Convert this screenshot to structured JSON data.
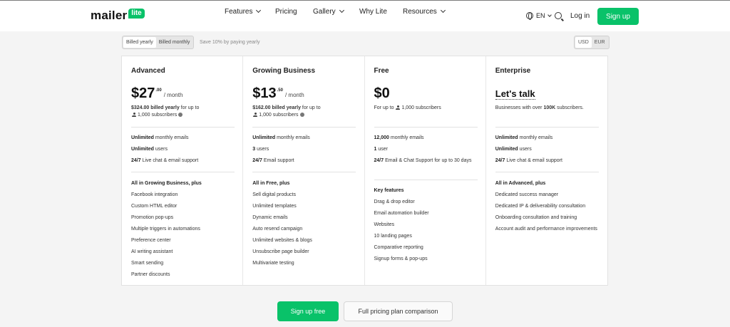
{
  "header": {
    "logo_text": "mailer",
    "logo_badge": "lite",
    "nav": [
      {
        "label": "Features",
        "has_dropdown": true
      },
      {
        "label": "Pricing",
        "has_dropdown": false
      },
      {
        "label": "Gallery",
        "has_dropdown": true
      },
      {
        "label": "Why Lite",
        "has_dropdown": false
      },
      {
        "label": "Resources",
        "has_dropdown": true
      }
    ],
    "language": "EN",
    "login_label": "Log in",
    "signup_label": "Sign up",
    "brand_color": "#09c269"
  },
  "billing": {
    "yearly_label": "Billed yearly",
    "monthly_label": "Billed monthly",
    "save_note": "Save 10% by paying yearly",
    "currency_usd": "USD",
    "currency_eur": "EUR"
  },
  "plans": [
    {
      "name": "Advanced",
      "price": "$27",
      "cents": ".00",
      "per": "/ month",
      "billed_amount": "$324.00 billed yearly",
      "billed_rest": " for up to",
      "subscribers": "1,000 subscribers",
      "features": [
        {
          "bold": "Unlimited",
          "rest": " monthly emails"
        },
        {
          "bold": "Unlimited",
          "rest": " users"
        },
        {
          "bold": "24/7",
          "rest": " Live chat & email support"
        }
      ],
      "extras_heading": "All in Growing Business, plus",
      "extras": [
        "Facebook integration",
        "Custom HTML editor",
        "Promotion pop-ups",
        "Multiple triggers in automations",
        "Preference center",
        "AI writing assistant",
        "Smart sending",
        "Partner discounts"
      ]
    },
    {
      "name": "Growing Business",
      "price": "$13",
      "cents": ".50",
      "per": "/ month",
      "billed_amount": "$162.00 billed yearly",
      "billed_rest": " for up to",
      "subscribers": "1,000 subscribers",
      "features": [
        {
          "bold": "Unlimited",
          "rest": " monthly emails"
        },
        {
          "bold": "3",
          "rest": " users"
        },
        {
          "bold": "24/7",
          "rest": " Email support"
        }
      ],
      "extras_heading": "All in Free, plus",
      "extras": [
        "Sell digital products",
        "Unlimited templates",
        "Dynamic emails",
        "Auto resend campaign",
        "Unlimited websites & blogs",
        "Unsubscribe page builder",
        "Multivariate testing"
      ]
    },
    {
      "name": "Free",
      "price": "$0",
      "desc_prefix": "For up to",
      "subscribers": "1,000 subscribers",
      "features": [
        {
          "bold": "12,000",
          "rest": " monthly emails"
        },
        {
          "bold": "1",
          "rest": " user"
        },
        {
          "bold": "24/7",
          "rest": " Email & Chat Support for up to 30 days"
        }
      ],
      "extras_heading": "Key features",
      "extras": [
        "Drag & drop editor",
        "Email automation builder",
        "Websites",
        "10 landing pages",
        "Comparative reporting",
        "Signup forms & pop-ups"
      ]
    },
    {
      "name": "Enterprise",
      "price": "Let's talk",
      "desc_prefix": "Businesses with over ",
      "desc_bold": "100K",
      "desc_suffix": " subscribers.",
      "features": [
        {
          "bold": "Unlimited",
          "rest": " monthly emails"
        },
        {
          "bold": "Unlimited",
          "rest": " users"
        },
        {
          "bold": "24/7",
          "rest": " Live chat & email support"
        }
      ],
      "extras_heading": "All in Advanced, plus",
      "extras": [
        "Dedicated success manager",
        "Dedicated IP & deliverability consultation",
        "Onboarding consultation and training",
        "Account audit and performance improvements"
      ]
    }
  ],
  "footer": {
    "signup_free_label": "Sign up free",
    "comparison_label": "Full pricing plan comparison"
  }
}
